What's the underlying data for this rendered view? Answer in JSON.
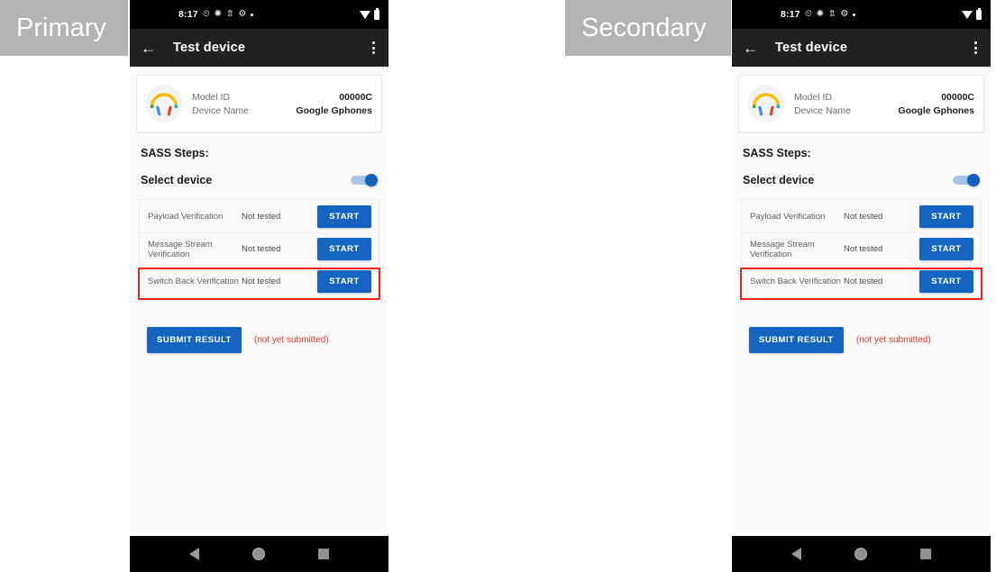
{
  "annotations": {
    "primary_label": "Primary",
    "secondary_label": "Secondary"
  },
  "colors": {
    "accent_blue": "#1565c0",
    "highlight_red": "#f5221b",
    "toolbar_dark": "#212121",
    "note_red": "#e8312a",
    "chip_gray": "#b3b3b3"
  },
  "phone": {
    "statusbar": {
      "time": "8:17",
      "icons": [
        "alarm-icon",
        "brightness-icon",
        "bluetooth-icon",
        "gear-icon",
        "dot-icon"
      ],
      "right_icons": [
        "wifi-icon",
        "battery-icon"
      ]
    },
    "toolbar": {
      "back_icon": "arrow-back-icon",
      "title": "Test device",
      "menu_icon": "overflow-menu-icon"
    },
    "device_card": {
      "icon": "headphones-icon",
      "rows": [
        {
          "label": "Model ID",
          "value": "00000C"
        },
        {
          "label": "Device Name",
          "value": "Google Gphones"
        }
      ]
    },
    "sass": {
      "section_title": "SASS Steps:",
      "select_device_label": "Select device",
      "select_device_toggle": "on",
      "steps": [
        {
          "name": "Payload Verification",
          "status": "Not tested",
          "action": "START",
          "highlighted": false
        },
        {
          "name": "Message Stream Verification",
          "status": "Not tested",
          "action": "START",
          "highlighted": false
        },
        {
          "name": "Switch Back Verification",
          "status": "Not tested",
          "action": "START",
          "highlighted": true
        }
      ]
    },
    "submit": {
      "button_label": "SUBMIT RESULT",
      "note": "(not yet submitted)"
    },
    "navbar": {
      "back": "nav-back-icon",
      "home": "nav-home-icon",
      "recents": "nav-recents-icon"
    }
  }
}
